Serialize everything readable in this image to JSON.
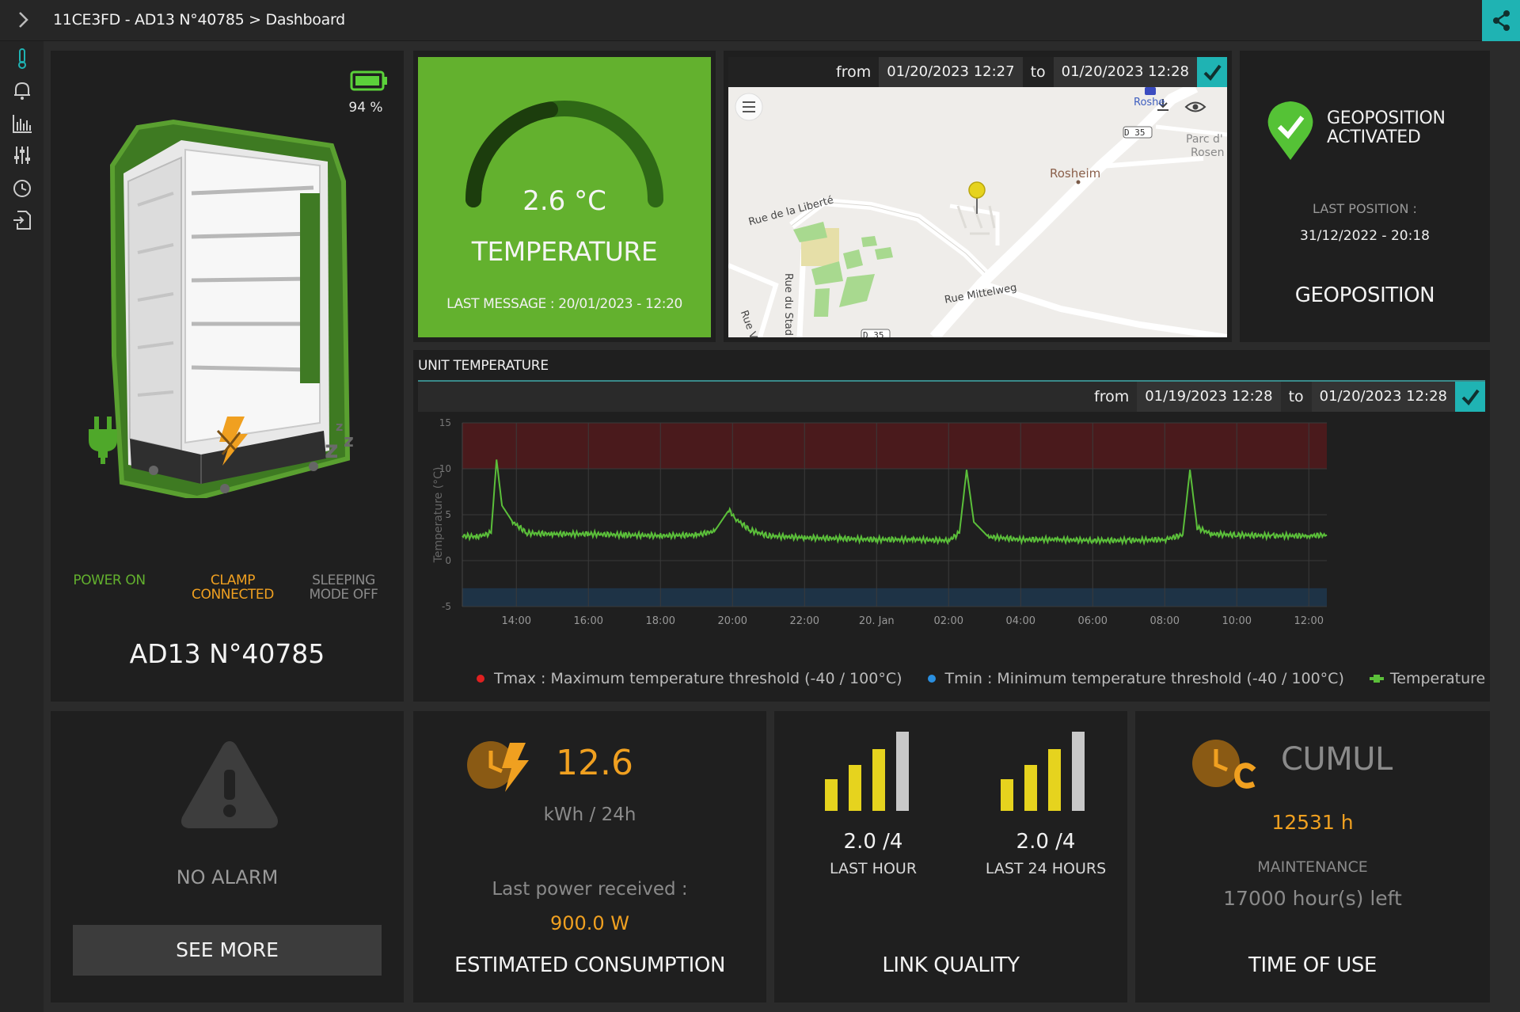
{
  "breadcrumb": "11CE3FD - AD13 N°40785 > Dashboard",
  "device": {
    "battery_pct": "94 %",
    "name": "AD13 N°40785",
    "status": [
      {
        "label_1": "POWER ON",
        "label_2": ""
      },
      {
        "label_1": "CLAMP",
        "label_2": "CONNECTED"
      },
      {
        "label_1": "SLEEPING",
        "label_2": "MODE OFF"
      }
    ]
  },
  "temperature": {
    "value": "2.6 °C",
    "label": "TEMPERATURE",
    "last_message": "LAST MESSAGE : 20/01/2023 - 12:20",
    "gauge_fraction": 0.45
  },
  "map": {
    "from_label": "from",
    "from": "01/20/2023 12:27",
    "to_label": "to",
    "to": "01/20/2023 12:28",
    "labels": {
      "rosheim": "Rosheim",
      "rosheim_top": "Roshe",
      "parc_1": "Parc d'",
      "parc_2": "Rosen",
      "road_d35": "D 35",
      "road_d35_b": "D 35",
      "rue_liberte": "Rue de la Liberté",
      "rue_stad": "Rue du Stad",
      "rue_mittelweg": "Rue Mittelweg",
      "rue_v": "Rue V"
    }
  },
  "geo": {
    "status_1": "GEOPOSITION",
    "status_2": "ACTIVATED",
    "last_position_label": "LAST POSITION :",
    "last_position": "31/12/2022 - 20:18",
    "title": "GEOPOSITION"
  },
  "unit_temp": {
    "title": "UNIT TEMPERATURE",
    "from_label": "from",
    "from": "01/19/2023 12:28",
    "to_label": "to",
    "to": "01/20/2023 12:28",
    "legend": [
      {
        "label": "Tmax : Maximum temperature threshold (-40 / 100°C)",
        "color": "#e02020"
      },
      {
        "label": "Tmin : Minimum temperature threshold (-40 / 100°C)",
        "color": "#2a8fe0"
      },
      {
        "label": "Temperature",
        "color": "#5bbf3a"
      }
    ]
  },
  "chart_data": {
    "type": "line",
    "title": "",
    "ylabel": "Temperature (°C)",
    "xlabel": "",
    "ylim": [
      -5,
      15
    ],
    "yticks": [
      "15",
      "10",
      "5",
      "0",
      "-5"
    ],
    "xticks": [
      "14:00",
      "16:00",
      "18:00",
      "20:00",
      "22:00",
      "20. Jan",
      "02:00",
      "04:00",
      "06:00",
      "08:00",
      "10:00",
      "12:00"
    ],
    "bands": [
      {
        "name": "Tmax",
        "from": 10,
        "to": 15,
        "color": "#4a1a1c"
      },
      {
        "name": "Tmin",
        "from": -5,
        "to": -3,
        "color": "#1e3346"
      }
    ],
    "series": [
      {
        "name": "Temperature",
        "color": "#5bbf3a",
        "x_hours": [
          0,
          0.4,
          0.8,
          0.95,
          1.1,
          1.4,
          1.8,
          2.5,
          3.5,
          4.5,
          5.5,
          6.5,
          7.0,
          7.4,
          7.6,
          8.0,
          8.5,
          9.5,
          10.5,
          11.5,
          12.5,
          13.5,
          13.8,
          14.0,
          14.2,
          14.6,
          15.5,
          16.5,
          17.5,
          18.5,
          19.5,
          20.0,
          20.2,
          20.4,
          20.8,
          21.5,
          22.5,
          23.5,
          24.0
        ],
        "y": [
          2.7,
          2.6,
          3.0,
          11.0,
          6.0,
          4.2,
          3.0,
          2.9,
          2.9,
          2.8,
          2.7,
          2.8,
          3.2,
          5.5,
          4.5,
          3.3,
          2.7,
          2.5,
          2.4,
          2.3,
          2.3,
          2.2,
          3.0,
          9.9,
          4.2,
          2.6,
          2.3,
          2.3,
          2.2,
          2.2,
          2.3,
          2.8,
          9.9,
          3.6,
          2.9,
          2.8,
          2.7,
          2.7,
          2.8
        ]
      }
    ]
  },
  "alarm": {
    "text": "NO ALARM",
    "button": "SEE MORE"
  },
  "consumption": {
    "value": "12.6",
    "unit": "kWh / 24h",
    "last_power_label": "Last power received :",
    "last_power": "900.0 W",
    "title": "ESTIMATED CONSUMPTION"
  },
  "link": {
    "hour_value": "2.0 /4",
    "hour_label": "LAST HOUR",
    "day_value": "2.0 /4",
    "day_label": "LAST 24 HOURS",
    "hour_level": 2,
    "day_level": 2,
    "title": "LINK QUALITY"
  },
  "time_of_use": {
    "cumul_label": "CUMUL",
    "cumul_value": "12531 h",
    "maintenance_label": "MAINTENANCE",
    "maintenance_left": "17000 hour(s) left",
    "title": "TIME OF USE"
  },
  "colors": {
    "accent": "#1fb3b3",
    "green": "#63b12e",
    "orange": "#f0a020"
  }
}
